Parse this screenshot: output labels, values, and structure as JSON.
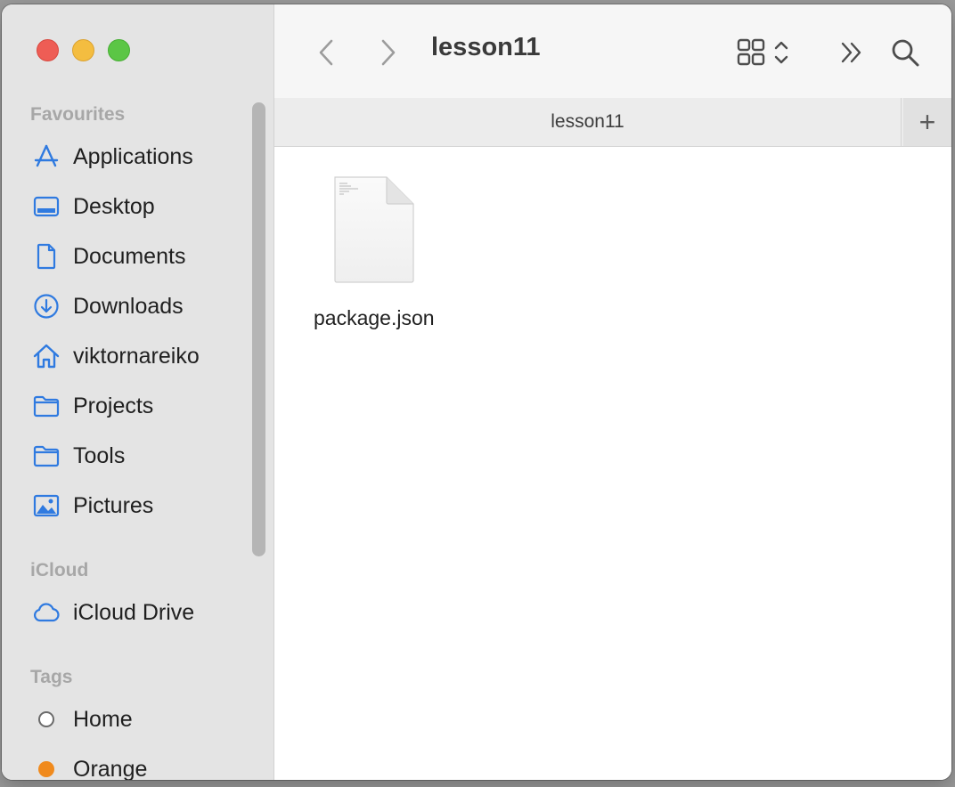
{
  "window": {
    "title": "lesson11"
  },
  "traffic_lights": [
    "close",
    "minimize",
    "zoom"
  ],
  "sidebar": {
    "favourites_title": "Favourites",
    "favourites": [
      {
        "label": "Applications",
        "icon": "applications-icon"
      },
      {
        "label": "Desktop",
        "icon": "desktop-icon"
      },
      {
        "label": "Documents",
        "icon": "document-icon"
      },
      {
        "label": "Downloads",
        "icon": "download-icon"
      },
      {
        "label": "viktornareiko",
        "icon": "home-icon"
      },
      {
        "label": "Projects",
        "icon": "folder-icon"
      },
      {
        "label": "Tools",
        "icon": "folder-icon"
      },
      {
        "label": "Pictures",
        "icon": "pictures-icon"
      }
    ],
    "icloud_title": "iCloud",
    "icloud": [
      {
        "label": "iCloud Drive",
        "icon": "cloud-icon"
      }
    ],
    "tags_title": "Tags",
    "tags": [
      {
        "label": "Home",
        "color": "#ffffff"
      },
      {
        "label": "Orange",
        "color": "#f08a1d"
      }
    ]
  },
  "tabbar": {
    "tab_label": "lesson11",
    "add_label": "+"
  },
  "files": [
    {
      "name": "package.json"
    }
  ],
  "colors": {
    "accent": "#2f7ae0"
  }
}
